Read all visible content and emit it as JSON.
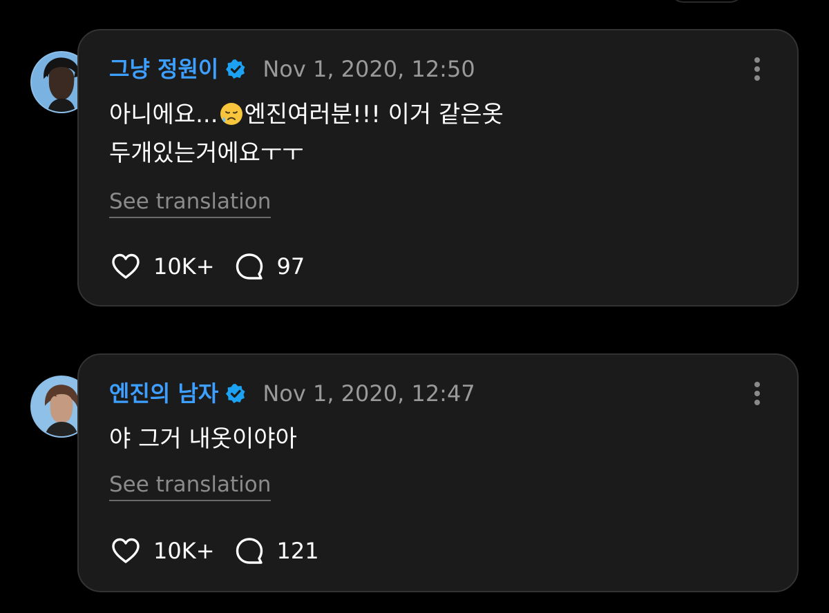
{
  "colors": {
    "background": "#000000",
    "card": "#1b1b1b",
    "username": "#3d9fff",
    "verified_badge": "#1da1f2",
    "timestamp": "#9a9a9a",
    "link_text": "#8b8b8b"
  },
  "posts": [
    {
      "username": "그냥 정원이",
      "verified": true,
      "timestamp": "Nov 1, 2020, 12:50",
      "text_line_1_part_1": "아니에요...",
      "emoji": "sad-but-relieved-face",
      "text_line_1_part_2": "엔진여러분!!! 이거 같은옷",
      "text_line_2": "두개있는거에요ㅜㅜ",
      "see_translation": "See translation",
      "likes": "10K+",
      "comments": "97",
      "icons": [
        "verified-badge-icon",
        "more-options-icon",
        "heart-icon",
        "comment-bubble-icon"
      ]
    },
    {
      "username": "엔진의 남자",
      "verified": true,
      "timestamp": "Nov 1, 2020, 12:47",
      "text_line_1": "야 그거 내옷이야아",
      "see_translation": "See translation",
      "likes": "10K+",
      "comments": "121",
      "icons": [
        "verified-badge-icon",
        "more-options-icon",
        "heart-icon",
        "comment-bubble-icon"
      ]
    }
  ]
}
